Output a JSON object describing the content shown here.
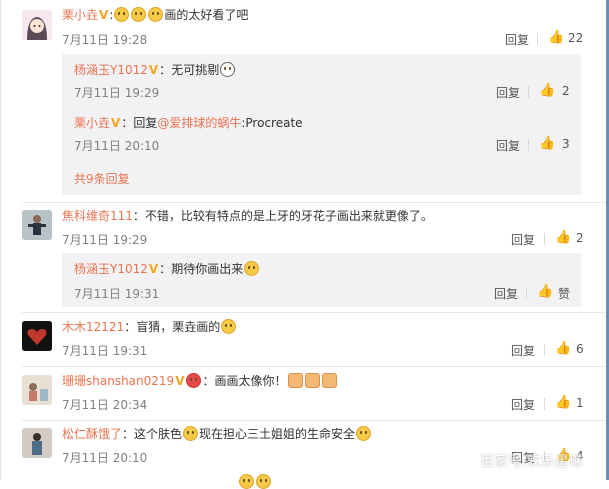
{
  "comments": [
    {
      "user": "栗小垚",
      "text_after": "画的太好看了吧",
      "time": "7月11日 19:28",
      "reply_label": "回复",
      "likes": "22",
      "sub": [
        {
          "user": "杨涵玉Y1012",
          "text": "无可挑剔",
          "time": "7月11日 19:29",
          "reply_label": "回复",
          "likes": "2"
        },
        {
          "user": "栗小垚",
          "reply_prefix": "回复",
          "mention": "@爱排球的蜗牛",
          "text": ":Procreate",
          "time": "7月11日 20:10",
          "reply_label": "回复",
          "likes": "3"
        }
      ],
      "more_label": "共9条回复"
    },
    {
      "user": "焦科维奇111",
      "text": "不错，比较有特点的是上牙的牙花子画出来就更像了。",
      "time": "7月11日 19:29",
      "reply_label": "回复",
      "likes": "2",
      "sub": [
        {
          "user": "杨涵玉Y1012",
          "text": "期待你画出来",
          "time": "7月11日 19:31",
          "reply_label": "回复",
          "likes": "赞"
        }
      ]
    },
    {
      "user": "木木12121",
      "text": "盲猜，栗垚画的",
      "time": "7月11日 19:31",
      "reply_label": "回复",
      "likes": "6"
    },
    {
      "user": "珊珊shanshan0219",
      "text": "画画太像你！",
      "time": "7月11日 20:34",
      "reply_label": "回复",
      "likes": "1"
    },
    {
      "user": "松仁酥饿了",
      "text_before": "这个肤色",
      "text_after": "现在担心三土姐姐的生命安全",
      "time": "7月11日 20:10",
      "reply_label": "回复",
      "likes": "4"
    }
  ],
  "watermark": "百家号/欢乐星球",
  "icons": {
    "like": "thumbs-up-icon",
    "vip": "v-badge-icon"
  },
  "colors": {
    "username": "#eb7350",
    "vip_badge": "#f6a623",
    "sub_background": "#f2f2f5"
  }
}
